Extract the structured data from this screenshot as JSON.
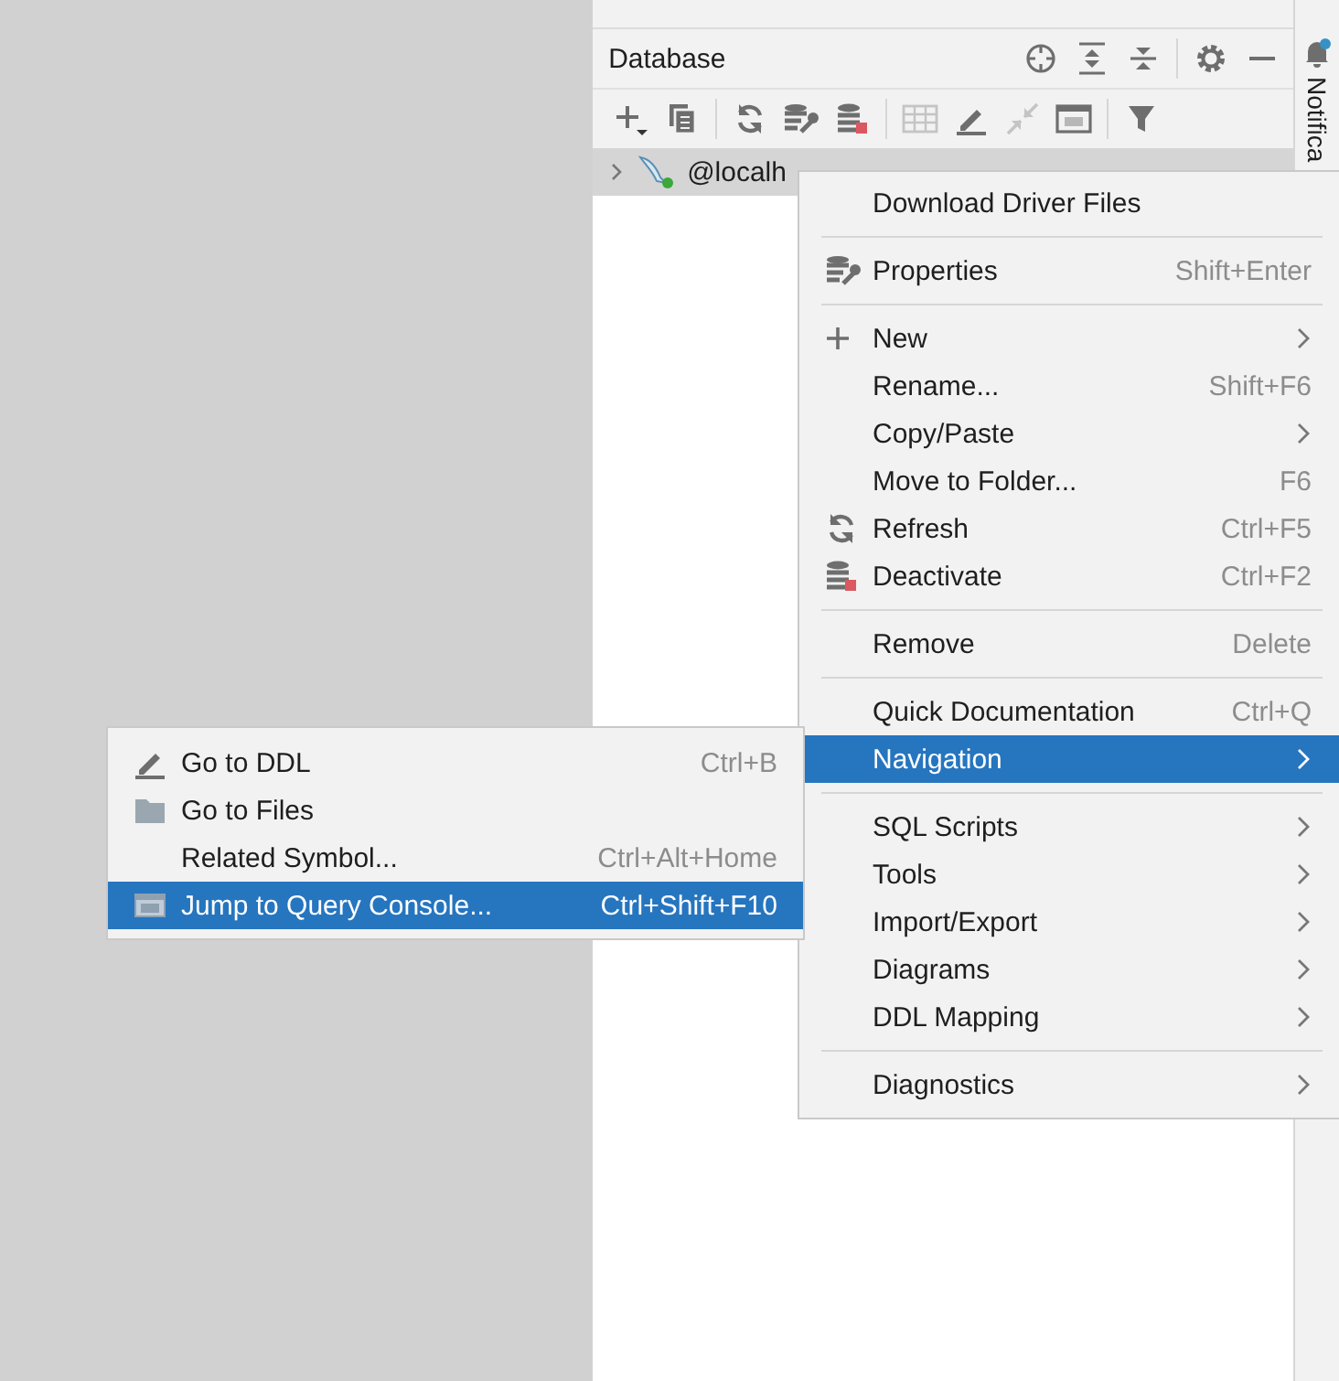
{
  "panel": {
    "title": "Database"
  },
  "tree": [
    {
      "label": "@localh",
      "expanded": false,
      "selected": true
    }
  ],
  "side_stripe": {
    "label": "Notifica"
  },
  "context_menu": {
    "groups": [
      [
        {
          "label": "Download Driver Files",
          "submenu": false,
          "selected": false
        }
      ],
      [
        {
          "label": "Properties",
          "shortcut": "Shift+Enter",
          "submenu": false,
          "selected": false
        }
      ],
      [
        {
          "label": "New",
          "submenu": true,
          "selected": false
        },
        {
          "label": "Rename...",
          "shortcut": "Shift+F6",
          "submenu": false,
          "selected": false
        },
        {
          "label": "Copy/Paste",
          "submenu": true,
          "selected": false
        },
        {
          "label": "Move to Folder...",
          "shortcut": "F6",
          "submenu": false,
          "selected": false
        },
        {
          "label": "Refresh",
          "shortcut": "Ctrl+F5",
          "submenu": false,
          "selected": false
        },
        {
          "label": "Deactivate",
          "shortcut": "Ctrl+F2",
          "submenu": false,
          "selected": false
        }
      ],
      [
        {
          "label": "Remove",
          "shortcut": "Delete",
          "submenu": false,
          "selected": false
        }
      ],
      [
        {
          "label": "Quick Documentation",
          "shortcut": "Ctrl+Q",
          "submenu": false,
          "selected": false
        },
        {
          "label": "Navigation",
          "submenu": true,
          "selected": true
        }
      ],
      [
        {
          "label": "SQL Scripts",
          "submenu": true,
          "selected": false
        },
        {
          "label": "Tools",
          "submenu": true,
          "selected": false
        },
        {
          "label": "Import/Export",
          "submenu": true,
          "selected": false
        },
        {
          "label": "Diagrams",
          "submenu": true,
          "selected": false
        },
        {
          "label": "DDL Mapping",
          "submenu": true,
          "selected": false
        }
      ],
      [
        {
          "label": "Diagnostics",
          "submenu": true,
          "selected": false
        }
      ]
    ]
  },
  "submenu": {
    "items": [
      {
        "label": "Go to DDL",
        "shortcut": "Ctrl+B",
        "selected": false
      },
      {
        "label": "Go to Files",
        "selected": false
      },
      {
        "label": "Related Symbol...",
        "shortcut": "Ctrl+Alt+Home",
        "selected": false
      },
      {
        "label": "Jump to Query Console...",
        "shortcut": "Ctrl+Shift+F10",
        "selected": true
      }
    ]
  }
}
